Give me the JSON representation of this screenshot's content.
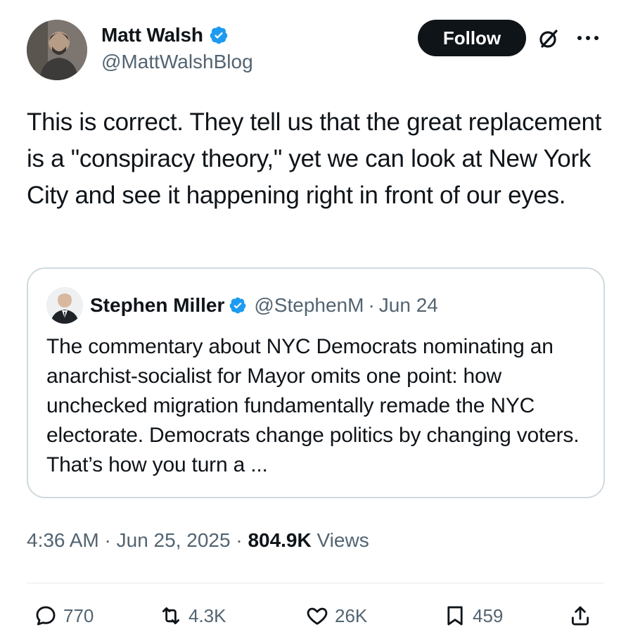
{
  "author": {
    "display_name": "Matt Walsh",
    "handle": "@MattWalshBlog",
    "verified": true
  },
  "follow_label": "Follow",
  "post_text": "This is correct. They tell us that the great replacement is a \"conspiracy theory,\" yet we can look at New York City and see it happening right in front of our eyes.",
  "quoted": {
    "display_name": "Stephen Miller",
    "handle": "@StephenM",
    "separator": "·",
    "date": "Jun 24",
    "text": "The commentary about NYC Democrats nominating an anarchist-socialist for Mayor omits one point: how unchecked migration fundamentally remade the NYC electorate. Democrats change politics by changing voters. That’s how you turn a ..."
  },
  "meta": {
    "time": "4:36 AM",
    "separator": "·",
    "date": "Jun 25, 2025",
    "views_count": "804.9K",
    "views_label": "Views"
  },
  "actions": {
    "replies": "770",
    "reposts": "4.3K",
    "likes": "26K",
    "bookmarks": "459"
  },
  "colors": {
    "verified": "#1d9bf0",
    "text": "#0f1419",
    "muted": "#536471",
    "border": "#cfd9de"
  },
  "icons": [
    "verified-badge-icon",
    "grok-icon",
    "more-icon",
    "reply-icon",
    "repost-icon",
    "like-icon",
    "bookmark-icon",
    "share-icon"
  ]
}
